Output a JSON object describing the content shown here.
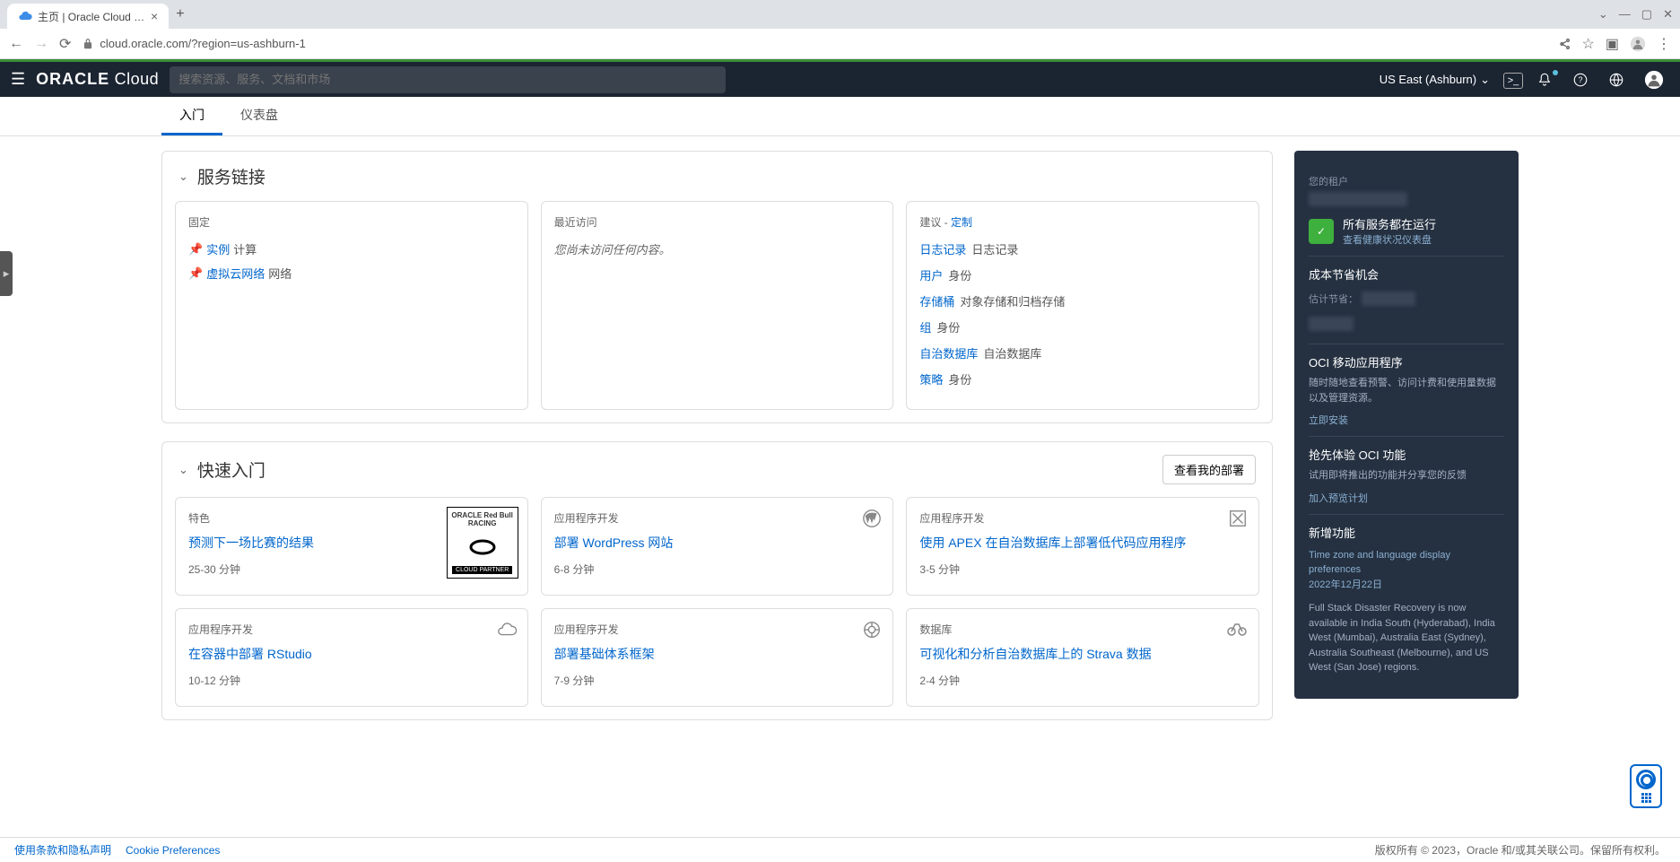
{
  "browser": {
    "tab_title": "主页 | Oracle Cloud Infrastr",
    "url": "cloud.oracle.com/?region=us-ashburn-1"
  },
  "header": {
    "logo_bold": "ORACLE",
    "logo_light": "Cloud",
    "search_placeholder": "搜索资源、服务、文档和市场",
    "region": "US East (Ashburn)"
  },
  "tabs": {
    "getting_started": "入门",
    "dashboard": "仪表盘"
  },
  "service_links": {
    "title": "服务链接",
    "pinned": {
      "label": "固定",
      "items": [
        {
          "link": "实例",
          "text": "计算"
        },
        {
          "link": "虚拟云网络",
          "text": "网络"
        }
      ]
    },
    "recent": {
      "label": "最近访问",
      "empty": "您尚未访问任何内容。"
    },
    "suggest": {
      "label": "建议 -",
      "customize": "定制",
      "items": [
        {
          "link": "日志记录",
          "text": "日志记录"
        },
        {
          "link": "用户",
          "text": "身份"
        },
        {
          "link": "存储桶",
          "text": "对象存储和归档存储"
        },
        {
          "link": "组",
          "text": "身份"
        },
        {
          "link": "自治数据库",
          "text": "自治数据库"
        },
        {
          "link": "策略",
          "text": "身份"
        }
      ]
    }
  },
  "quickstart": {
    "title": "快速入门",
    "view_btn": "查看我的部署",
    "cards": [
      {
        "category": "特色",
        "title": "预测下一场比赛的结果",
        "time": "25-30 分钟",
        "icon": "redbull"
      },
      {
        "category": "应用程序开发",
        "title": "部署 WordPress 网站",
        "time": "6-8 分钟",
        "icon": "wordpress"
      },
      {
        "category": "应用程序开发",
        "title": "使用 APEX 在自治数据库上部署低代码应用程序",
        "time": "3-5 分钟",
        "icon": "apex"
      },
      {
        "category": "应用程序开发",
        "title": "在容器中部署 RStudio",
        "time": "10-12 分钟",
        "icon": "cloud"
      },
      {
        "category": "应用程序开发",
        "title": "部署基础体系框架",
        "time": "7-9 分钟",
        "icon": "terraform"
      },
      {
        "category": "数据库",
        "title": "可视化和分析自治数据库上的 Strava 数据",
        "time": "2-4 分钟",
        "icon": "bike"
      }
    ]
  },
  "redbull_box": {
    "top": "ORACLE Red Bull RACING",
    "bottom": "CLOUD PARTNER"
  },
  "sidebar": {
    "tenant_label": "您的租户",
    "status_title": "所有服务都在运行",
    "status_link": "查看健康状况仪表盘",
    "cost_title": "成本节省机会",
    "cost_label": "估计节省：",
    "mobile_title": "OCI 移动应用程序",
    "mobile_desc": "随时随地查看预警、访问计费和使用量数据以及管理资源。",
    "mobile_action": "立即安装",
    "preview_title": "抢先体验 OCI 功能",
    "preview_desc": "试用即将推出的功能并分享您的反馈",
    "preview_action": "加入预览计划",
    "news_title": "新增功能",
    "news1_title": "Time zone and language display preferences",
    "news1_date": "2022年12月22日",
    "news2": "Full Stack Disaster Recovery is now available in India South (Hyderabad), India West (Mumbai), Australia East (Sydney), Australia Southeast (Melbourne), and US West (San Jose) regions."
  },
  "footer": {
    "terms": "使用条款和隐私声明",
    "cookies": "Cookie Preferences",
    "copyright": "版权所有 © 2023，Oracle 和/或其关联公司。保留所有权利。"
  }
}
